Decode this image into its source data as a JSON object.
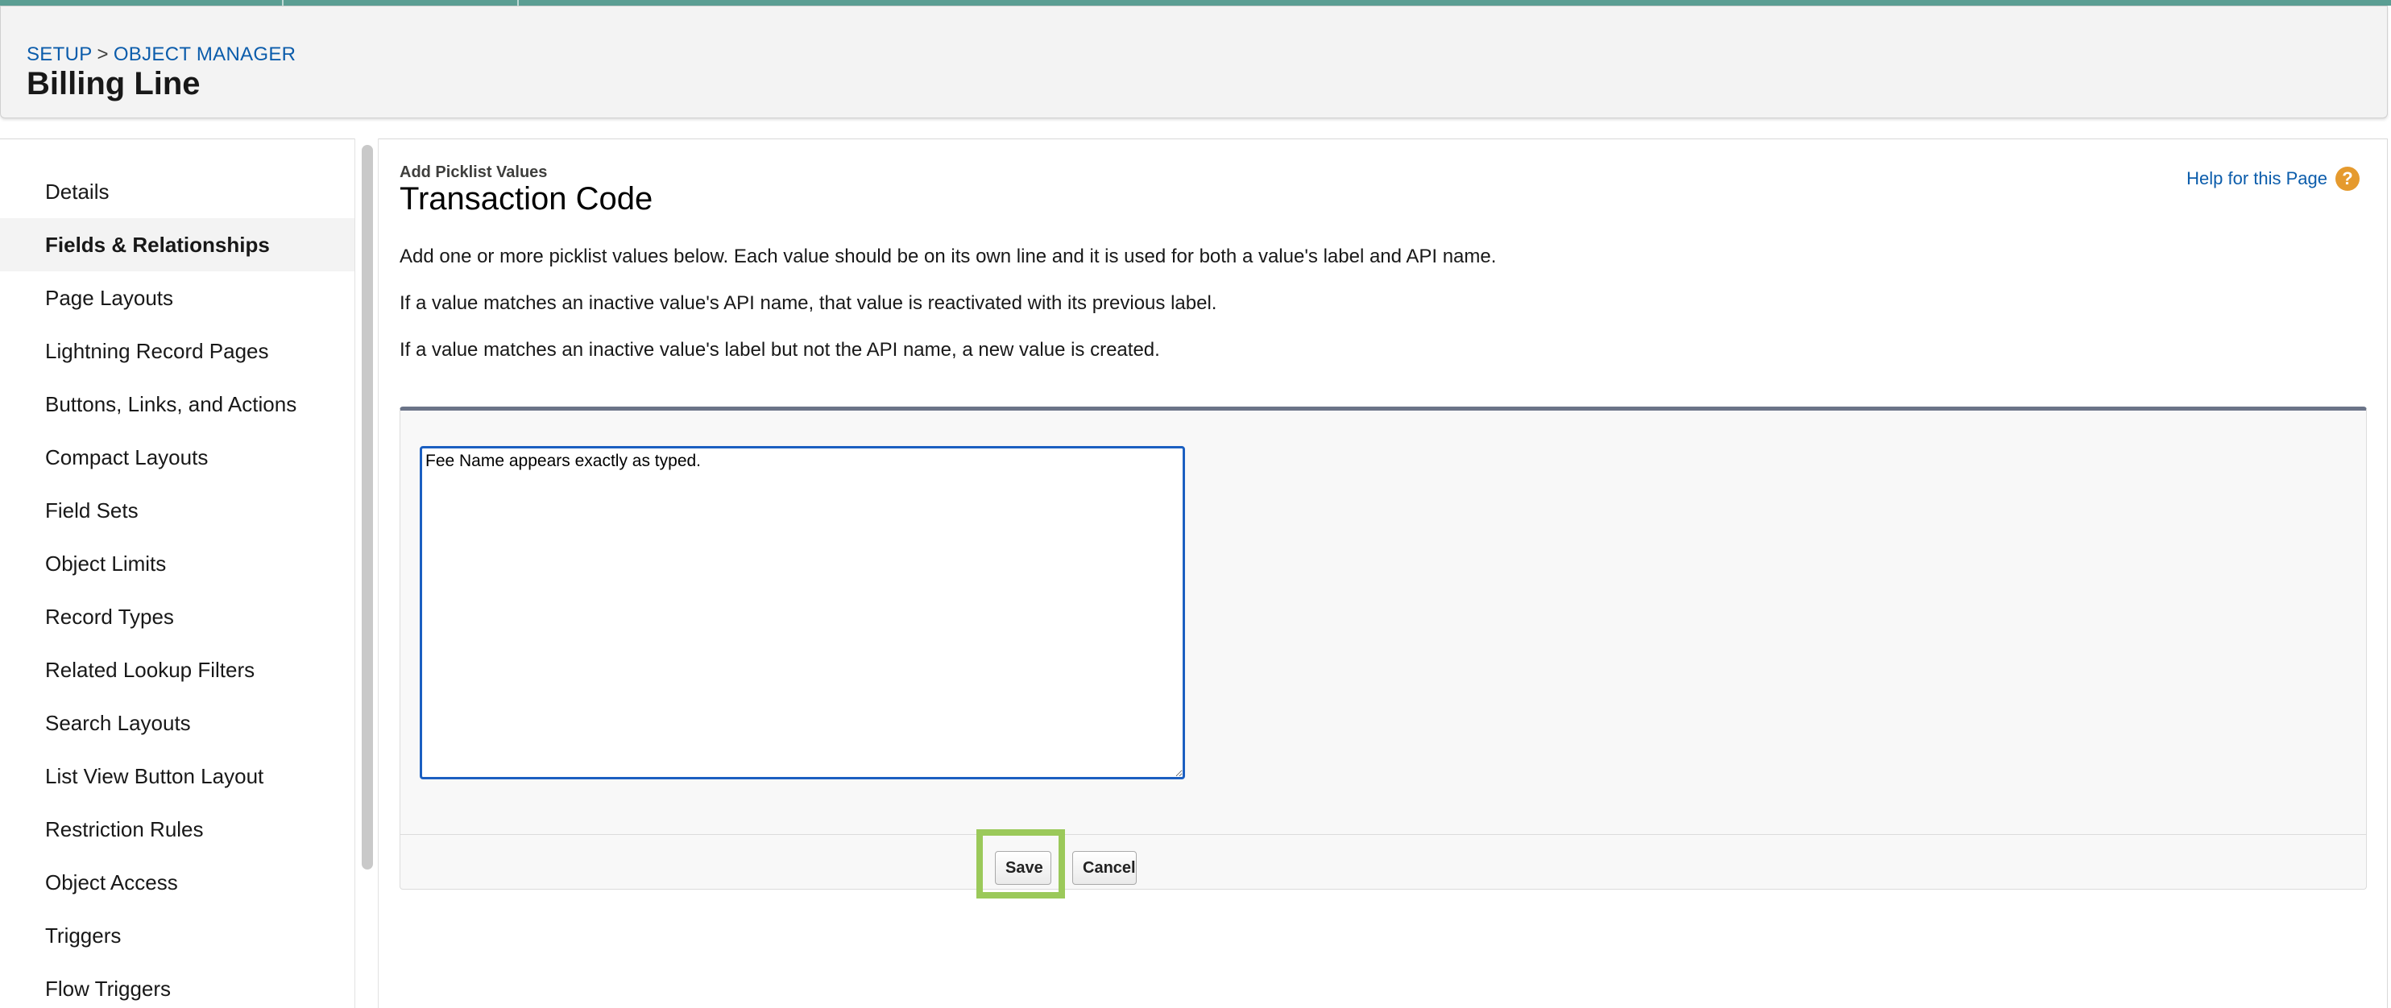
{
  "breadcrumb": {
    "setup": "SETUP",
    "separator": ">",
    "object_manager": "OBJECT MANAGER"
  },
  "page": {
    "title": "Billing Line"
  },
  "sidebar": {
    "items": [
      {
        "label": "Details"
      },
      {
        "label": "Fields & Relationships",
        "active": true
      },
      {
        "label": "Page Layouts"
      },
      {
        "label": "Lightning Record Pages"
      },
      {
        "label": "Buttons, Links, and Actions"
      },
      {
        "label": "Compact Layouts"
      },
      {
        "label": "Field Sets"
      },
      {
        "label": "Object Limits"
      },
      {
        "label": "Record Types"
      },
      {
        "label": "Related Lookup Filters"
      },
      {
        "label": "Search Layouts"
      },
      {
        "label": "List View Button Layout"
      },
      {
        "label": "Restriction Rules"
      },
      {
        "label": "Object Access"
      },
      {
        "label": "Triggers"
      },
      {
        "label": "Flow Triggers"
      }
    ]
  },
  "main": {
    "subtitle": "Add Picklist Values",
    "title": "Transaction Code",
    "help_label": "Help for this Page",
    "help_icon": "question-mark-icon",
    "help_icon_glyph": "?",
    "paragraphs": [
      "Add one or more picklist values below. Each value should be on its own line and it is used for both a value's label and API name.",
      "If a value matches an inactive value's API name, that value is reactivated with its previous label.",
      "If a value matches an inactive value's label but not the API name, a new value is created."
    ],
    "textarea_value": "Fee Name appears exactly as typed.",
    "save_label": "Save",
    "cancel_label": "Cancel"
  },
  "colors": {
    "link": "#0b5cab",
    "top_strip": "#5b9e93",
    "focus_border": "#1b5fc1",
    "highlight": "#9bc95a",
    "help_icon": "#e59a2e"
  }
}
